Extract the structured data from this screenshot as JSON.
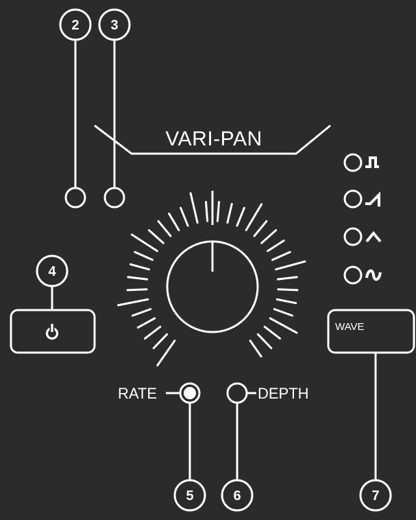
{
  "title": "VARI-PAN",
  "callouts": {
    "c2": "2",
    "c3": "3",
    "c4": "4",
    "c5": "5",
    "c6": "6",
    "c7": "7"
  },
  "controls": {
    "rate_label": "RATE",
    "depth_label": "DEPTH",
    "wave_button_label": "WAVE",
    "power_button": "power-icon"
  },
  "waveform_leds": [
    "square-wave-icon",
    "ramp-wave-icon",
    "triangle-wave-icon",
    "sine-wave-icon"
  ],
  "colors": {
    "background": "#2b2b2b",
    "line": "#ffffff",
    "led_active_fill": "#ffffff"
  }
}
